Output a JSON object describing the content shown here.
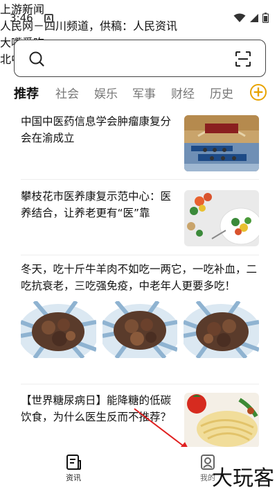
{
  "status_bar": {
    "time": "3:46",
    "a_icon": "A"
  },
  "search": {
    "placeholder": ""
  },
  "tabs": [
    {
      "label": "推荐",
      "active": true
    },
    {
      "label": "社会",
      "active": false
    },
    {
      "label": "娱乐",
      "active": false
    },
    {
      "label": "军事",
      "active": false
    },
    {
      "label": "财经",
      "active": false
    },
    {
      "label": "历史",
      "active": false
    }
  ],
  "add_tab_label": "+",
  "articles": [
    {
      "title": "中国中医药信息学会肿瘤康复分会在渝成立",
      "source": "上游新闻"
    },
    {
      "title": "攀枝花市医养康复示范中心：医养结合，让养老更有“医”靠",
      "source": "人民网－四川频道，供稿：人民资讯"
    },
    {
      "title": "冬天，吃十斤牛羊肉不如吃一两它，一吃补血，二吃抗衰老，三吃强免疫，中老年人更要多吃！",
      "source": "大嘴爱吃"
    },
    {
      "title": "【世界糖尿病日】能降糖的低碳饮食，为什么医生反而不推荐？",
      "source": "北中医东方医院"
    }
  ],
  "bottom_nav": {
    "news_label": "资讯",
    "mine_label": "我的"
  },
  "watermark": "大玩客",
  "colors": {
    "accent": "#e8a300",
    "arrow": "#e02020"
  }
}
